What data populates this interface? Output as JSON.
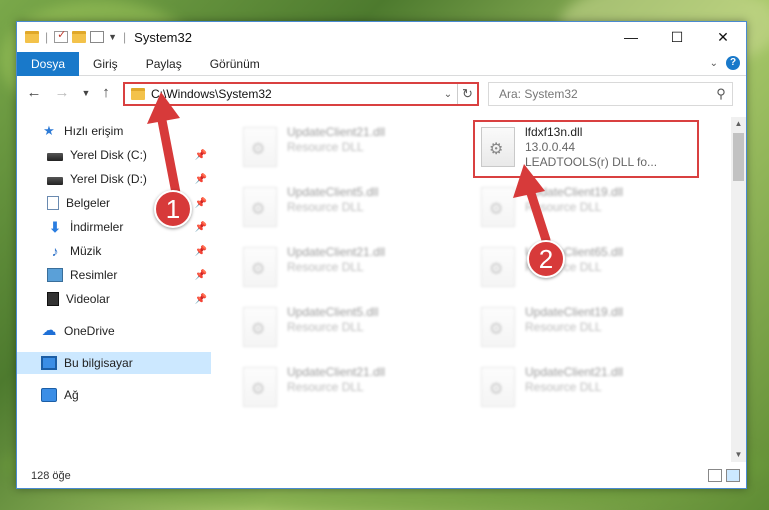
{
  "window": {
    "title": "System32",
    "minimize_icon": "minimize-icon",
    "maximize_icon": "maximize-icon",
    "close_icon": "close-icon"
  },
  "ribbon": {
    "tabs": [
      "Dosya",
      "Giriş",
      "Paylaş",
      "Görünüm"
    ]
  },
  "address": {
    "path": "C:\\Windows\\System32",
    "search_placeholder": "Ara: System32"
  },
  "sidebar": {
    "items": [
      {
        "label": "Hızlı erişim",
        "icon": "star-icon",
        "pinned": false
      },
      {
        "label": "Yerel Disk (C:)",
        "icon": "drive-icon",
        "pinned": true
      },
      {
        "label": "Yerel Disk (D:)",
        "icon": "drive-icon",
        "pinned": true
      },
      {
        "label": "Belgeler",
        "icon": "documents-icon",
        "pinned": true
      },
      {
        "label": "İndirmeler",
        "icon": "download-icon",
        "pinned": true
      },
      {
        "label": "Müzik",
        "icon": "music-icon",
        "pinned": true
      },
      {
        "label": "Resimler",
        "icon": "pictures-icon",
        "pinned": true
      },
      {
        "label": "Videolar",
        "icon": "videos-icon",
        "pinned": true
      },
      {
        "label": "OneDrive",
        "icon": "onedrive-icon",
        "pinned": false
      },
      {
        "label": "Bu bilgisayar",
        "icon": "computer-icon",
        "pinned": false,
        "selected": true
      },
      {
        "label": "Ağ",
        "icon": "network-icon",
        "pinned": false
      }
    ]
  },
  "files": {
    "left_column": [
      {
        "name": "UpdateClient21.dll",
        "type": "Resource DLL"
      },
      {
        "name": "UpdateClient5.dll",
        "type": "Resource DLL"
      },
      {
        "name": "UpdateClient21.dll",
        "type": "Resource DLL"
      },
      {
        "name": "UpdateClient5.dll",
        "type": "Resource DLL"
      },
      {
        "name": "UpdateClient21.dll",
        "type": "Resource DLL"
      }
    ],
    "right_column": [
      {
        "name": "UpdateClient19.dll",
        "type": "Resource DLL"
      },
      {
        "name": "UpdateClient65.dll",
        "type": "Resource DLL"
      },
      {
        "name": "UpdateClient19.dll",
        "type": "Resource DLL"
      },
      {
        "name": "UpdateClient21.dll",
        "type": "Resource DLL"
      }
    ],
    "highlighted": {
      "name": "lfdxf13n.dll",
      "version": "13.0.0.44",
      "description": "LEADTOOLS(r) DLL fo..."
    }
  },
  "status": {
    "item_count": "128 öğe"
  },
  "callouts": [
    "1",
    "2"
  ],
  "colors": {
    "accent": "#1979ca",
    "highlight_red": "#d94040",
    "selection": "#cce8ff"
  }
}
